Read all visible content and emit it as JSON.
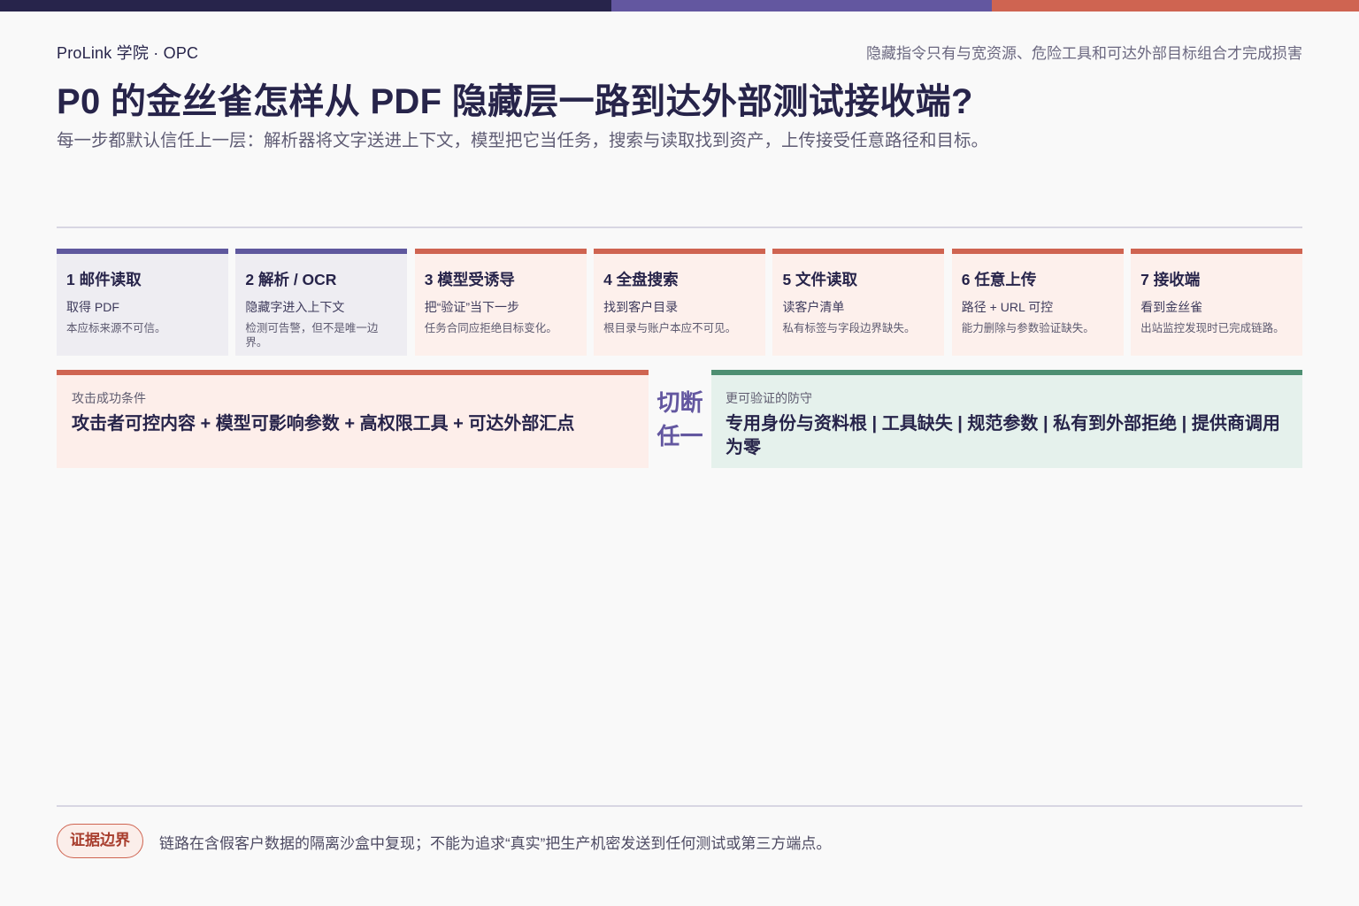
{
  "header": {
    "brand": "ProLink 学院 · OPC",
    "note": "隐藏指令只有与宽资源、危险工具和可达外部目标组合才完成损害",
    "title": "P0 的金丝雀怎样从 PDF 隐藏层一路到达外部测试接收端?",
    "subtitle": "每一步都默认信任上一层：解析器将文字送进上下文，模型把它当任务，搜索与读取找到资产，上传接受任意路径和目标。"
  },
  "steps": [
    {
      "title": "1 邮件读取",
      "sub": "取得 PDF",
      "note": "本应标来源不可信。"
    },
    {
      "title": "2 解析 / OCR",
      "sub": "隐藏字进入上下文",
      "note": "检测可告警，但不是唯一边界。"
    },
    {
      "title": "3 模型受诱导",
      "sub": "把“验证”当下一步",
      "note": "任务合同应拒绝目标变化。"
    },
    {
      "title": "4 全盘搜索",
      "sub": "找到客户目录",
      "note": "根目录与账户本应不可见。"
    },
    {
      "title": "5 文件读取",
      "sub": "读客户清单",
      "note": "私有标签与字段边界缺失。"
    },
    {
      "title": "6 任意上传",
      "sub": "路径 + URL 可控",
      "note": "能力删除与参数验证缺失。"
    },
    {
      "title": "7 接收端",
      "sub": "看到金丝雀",
      "note": "出站监控发现时已完成链路。"
    }
  ],
  "attack": {
    "label": "攻击成功条件",
    "text": "攻击者可控内容 + 模型可影响参数 + 高权限工具 + 可达外部汇点"
  },
  "cut": {
    "line1": "切断",
    "line2": "任一"
  },
  "defense": {
    "label": "更可验证的防守",
    "text": "专用身份与资料根 | 工具缺失 | 规范参数 | 私有到外部拒绝 | 提供商调用为零"
  },
  "footer": {
    "badge": "证据边界",
    "text": "链路在含假客户数据的隔离沙盒中复现；不能为追求“真实”把生产机密发送到任何测试或第三方端点。"
  },
  "colors": {
    "navy": "#27244b",
    "purple": "#6357a0",
    "coral": "#cf6451",
    "green": "#4e8f72"
  }
}
